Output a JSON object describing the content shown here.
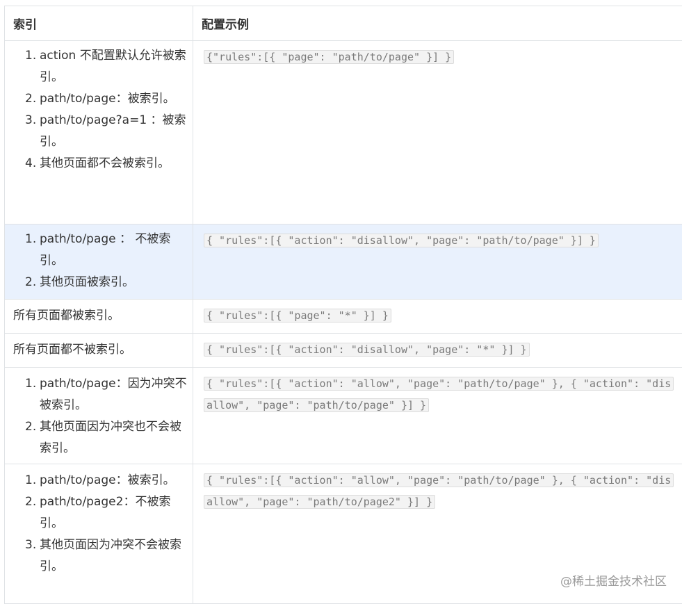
{
  "table": {
    "headers": [
      "索引",
      "配置示例"
    ],
    "rows": [
      {
        "items": [
          "action 不配置默认允许被索引。",
          "path/to/page：被索引。",
          "path/to/page?a=1 ：被索引。",
          "其他页面都不会被索引。"
        ],
        "code": "{\"rules\":[{ \"page\": \"path/to/page\" }] }"
      },
      {
        "items": [
          "path/to/page ： 不被索引。",
          "其他页面被索引。"
        ],
        "code": "{ \"rules\":[{ \"action\": \"disallow\", \"page\": \"path/to/page\" }] }"
      },
      {
        "text": "所有页面都被索引。",
        "code": "{ \"rules\":[{ \"page\": \"*\" }] }"
      },
      {
        "text": "所有页面都不被索引。",
        "code": "{ \"rules\":[{ \"action\": \"disallow\", \"page\": \"*\" }] }"
      },
      {
        "items": [
          "path/to/page：因为冲突不被索引。",
          "其他页面因为冲突也不会被索引。"
        ],
        "code": "{ \"rules\":[{ \"action\": \"allow\", \"page\": \"path/to/page\" }, { \"action\": \"disallow\", \"page\": \"path/to/page\" }] }"
      },
      {
        "items": [
          "path/to/page：被索引。",
          "path/to/page2：不被索引。",
          "其他页面因为冲突不会被索引。"
        ],
        "code": "{ \"rules\":[{ \"action\": \"allow\", \"page\": \"path/to/page\" }, { \"action\": \"disallow\", \"page\": \"path/to/page2\" }] }"
      }
    ]
  },
  "watermark": "@稀土掘金技术社区"
}
